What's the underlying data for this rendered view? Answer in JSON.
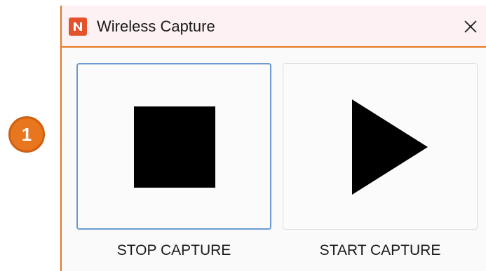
{
  "callout": {
    "number": "1"
  },
  "window": {
    "title": "Wireless Capture",
    "logo_icon": "app-logo-n-icon",
    "close_icon": "close-icon"
  },
  "buttons": {
    "stop": {
      "label": "STOP CAPTURE",
      "icon": "stop-icon"
    },
    "start": {
      "label": "START CAPTURE",
      "icon": "play-icon"
    }
  },
  "colors": {
    "accent_orange": "#e8761f",
    "logo_red": "#e5512b",
    "titlebar_bg": "#fdf1f3",
    "focus_border": "#6a9bd1"
  }
}
